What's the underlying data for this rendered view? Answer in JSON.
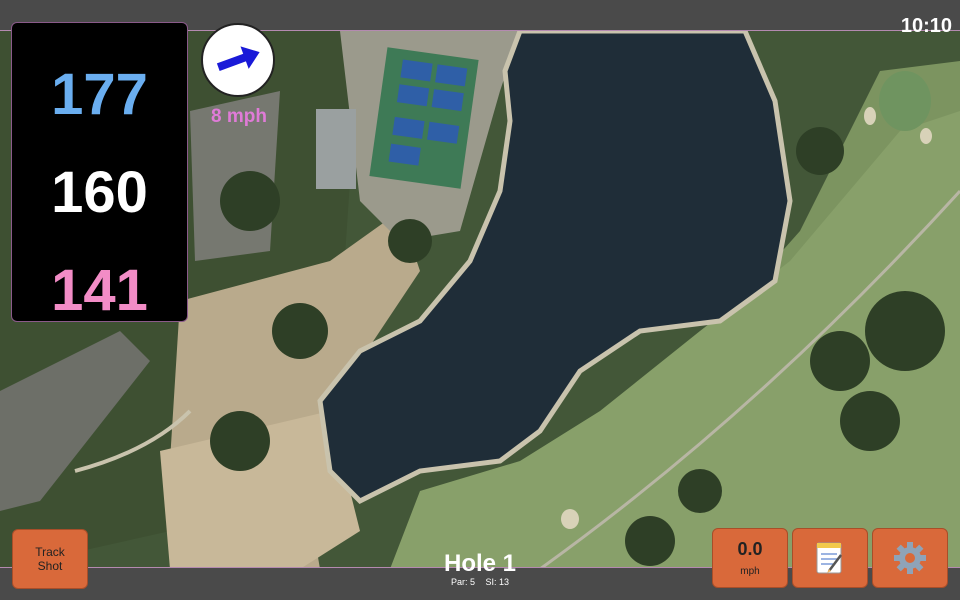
{
  "status": {
    "time": "10:10"
  },
  "distances": {
    "back": "177",
    "middle": "160",
    "front": "141"
  },
  "wind": {
    "speed": "8 mph",
    "icon": "arrow-icon"
  },
  "hole": {
    "title": "Hole 1",
    "par": "Par: 5",
    "si": "SI: 13"
  },
  "buttons": {
    "track_shot": "Track\nShot",
    "speed_value": "0.0",
    "speed_unit": "mph",
    "notes_icon": "notepad-icon",
    "settings_icon": "gear-icon"
  },
  "colors": {
    "back": "#6aaef0",
    "middle": "#ffffff",
    "front": "#f28cc6",
    "wind_text": "#e07bd8",
    "button": "#d9693a"
  }
}
